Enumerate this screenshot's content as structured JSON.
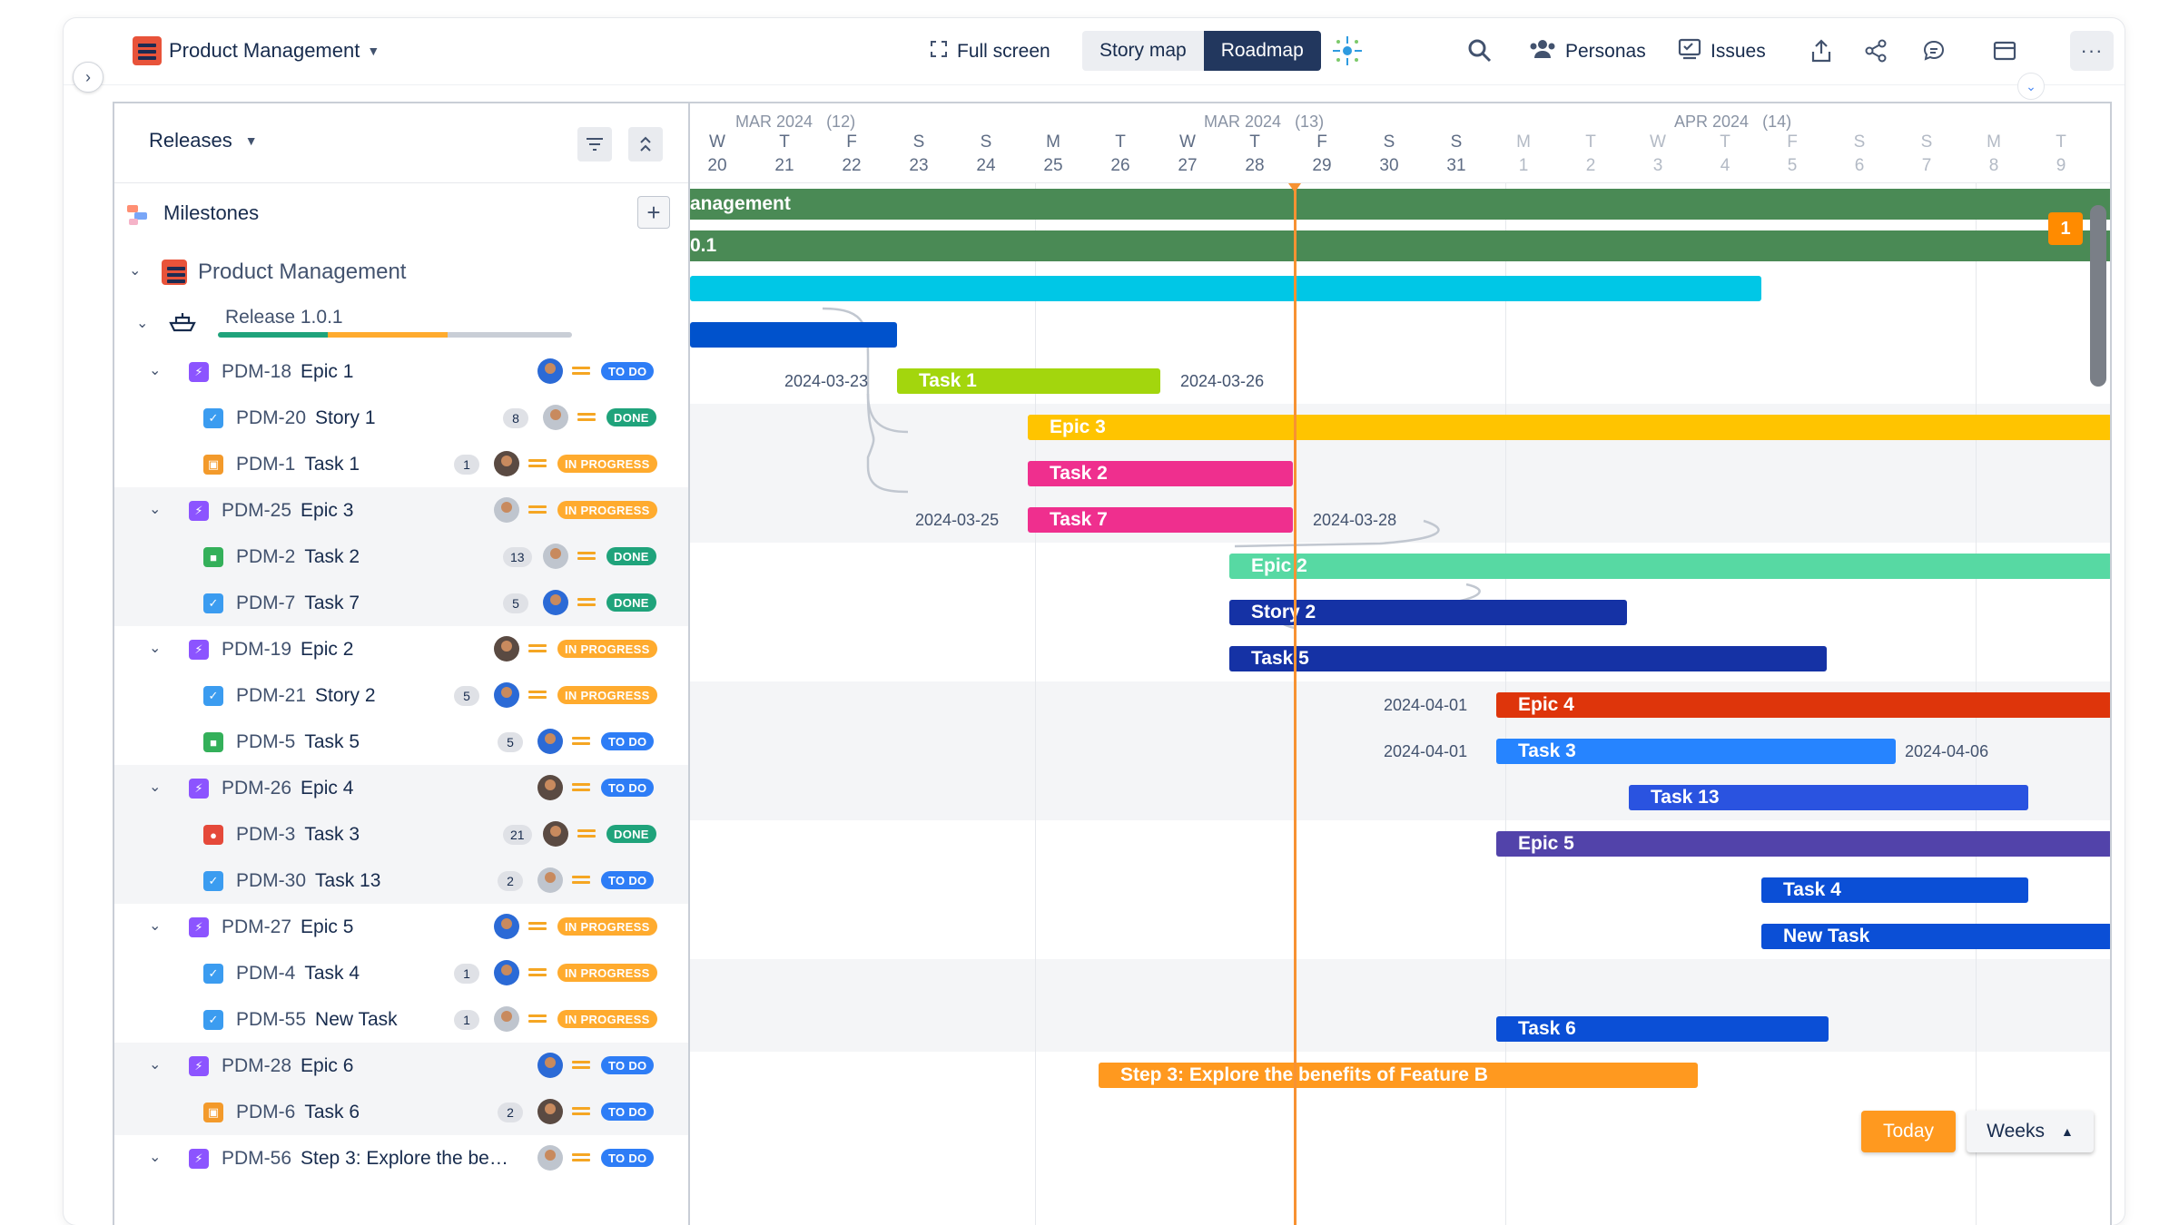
{
  "topbar": {
    "project_name": "Product Management",
    "full_screen": "Full screen",
    "story_map": "Story map",
    "roadmap": "Roadmap",
    "personas": "Personas",
    "issues": "Issues",
    "more": "···"
  },
  "left": {
    "releases_label": "Releases",
    "milestones_label": "Milestones",
    "project_label": "Product Management",
    "release_label": "Release 1.0.1",
    "release_progress": {
      "done": 0.31,
      "in_progress": 0.34,
      "todo": 0.35
    },
    "rows": [
      {
        "key": "PDM-18",
        "title": "Epic 1",
        "type": "epic",
        "count": "",
        "status": "TO DO",
        "status_kind": "todo",
        "avatar": "blue",
        "expandable": true,
        "shade": false
      },
      {
        "key": "PDM-20",
        "title": "Story 1",
        "type": "story",
        "count": "8",
        "status": "DONE",
        "status_kind": "done",
        "avatar": "grey",
        "expandable": false,
        "shade": false
      },
      {
        "key": "PDM-1",
        "title": "Task 1",
        "type": "task",
        "count": "1",
        "status": "IN PROGRESS",
        "status_kind": "prog",
        "avatar": "dark",
        "expandable": false,
        "shade": false
      },
      {
        "key": "PDM-25",
        "title": "Epic 3",
        "type": "epic",
        "count": "",
        "status": "IN PROGRESS",
        "status_kind": "prog",
        "avatar": "grey",
        "expandable": true,
        "shade": true
      },
      {
        "key": "PDM-2",
        "title": "Task 2",
        "type": "green",
        "count": "13",
        "status": "DONE",
        "status_kind": "done",
        "avatar": "grey",
        "expandable": false,
        "shade": true
      },
      {
        "key": "PDM-7",
        "title": "Task 7",
        "type": "story",
        "count": "5",
        "status": "DONE",
        "status_kind": "done",
        "avatar": "blue",
        "expandable": false,
        "shade": true
      },
      {
        "key": "PDM-19",
        "title": "Epic 2",
        "type": "epic",
        "count": "",
        "status": "IN PROGRESS",
        "status_kind": "prog",
        "avatar": "dark",
        "expandable": true,
        "shade": false
      },
      {
        "key": "PDM-21",
        "title": "Story 2",
        "type": "story",
        "count": "5",
        "status": "IN PROGRESS",
        "status_kind": "prog",
        "avatar": "blue",
        "expandable": false,
        "shade": false
      },
      {
        "key": "PDM-5",
        "title": "Task 5",
        "type": "green",
        "count": "5",
        "status": "TO DO",
        "status_kind": "todo",
        "avatar": "blue",
        "expandable": false,
        "shade": false
      },
      {
        "key": "PDM-26",
        "title": "Epic 4",
        "type": "epic",
        "count": "",
        "status": "TO DO",
        "status_kind": "todo",
        "avatar": "dark",
        "expandable": true,
        "shade": true
      },
      {
        "key": "PDM-3",
        "title": "Task 3",
        "type": "bug",
        "count": "21",
        "status": "DONE",
        "status_kind": "done",
        "avatar": "dark",
        "expandable": false,
        "shade": true
      },
      {
        "key": "PDM-30",
        "title": "Task 13",
        "type": "story",
        "count": "2",
        "status": "TO DO",
        "status_kind": "todo",
        "avatar": "grey",
        "expandable": false,
        "shade": true
      },
      {
        "key": "PDM-27",
        "title": "Epic 5",
        "type": "epic",
        "count": "",
        "status": "IN PROGRESS",
        "status_kind": "prog",
        "avatar": "blue",
        "expandable": true,
        "shade": false
      },
      {
        "key": "PDM-4",
        "title": "Task 4",
        "type": "story",
        "count": "1",
        "status": "IN PROGRESS",
        "status_kind": "prog",
        "avatar": "blue",
        "expandable": false,
        "shade": false
      },
      {
        "key": "PDM-55",
        "title": "New Task",
        "type": "story",
        "count": "1",
        "status": "IN PROGRESS",
        "status_kind": "prog",
        "avatar": "grey",
        "expandable": false,
        "shade": false
      },
      {
        "key": "PDM-28",
        "title": "Epic 6",
        "type": "epic",
        "count": "",
        "status": "TO DO",
        "status_kind": "todo",
        "avatar": "blue",
        "expandable": true,
        "shade": true
      },
      {
        "key": "PDM-6",
        "title": "Task 6",
        "type": "task",
        "count": "2",
        "status": "TO DO",
        "status_kind": "todo",
        "avatar": "dark",
        "expandable": false,
        "shade": true
      },
      {
        "key": "PDM-56",
        "title": "Step 3: Explore the be…",
        "type": "epic",
        "count": "",
        "status": "TO DO",
        "status_kind": "todo",
        "avatar": "grey",
        "expandable": true,
        "shade": false
      }
    ]
  },
  "timeline": {
    "months": [
      {
        "label": "MAR 2024",
        "week": "(12)"
      },
      {
        "label": "MAR 2024",
        "week": "(13)"
      },
      {
        "label": "APR 2024",
        "week": "(14)"
      }
    ],
    "days": [
      {
        "d": "W",
        "n": "20",
        "dim": false
      },
      {
        "d": "T",
        "n": "21",
        "dim": false
      },
      {
        "d": "F",
        "n": "22",
        "dim": false
      },
      {
        "d": "S",
        "n": "23",
        "dim": false
      },
      {
        "d": "S",
        "n": "24",
        "dim": false
      },
      {
        "d": "M",
        "n": "25",
        "dim": false
      },
      {
        "d": "T",
        "n": "26",
        "dim": false
      },
      {
        "d": "W",
        "n": "27",
        "dim": false
      },
      {
        "d": "T",
        "n": "28",
        "dim": false
      },
      {
        "d": "F",
        "n": "29",
        "dim": false
      },
      {
        "d": "S",
        "n": "30",
        "dim": false
      },
      {
        "d": "S",
        "n": "31",
        "dim": false
      },
      {
        "d": "M",
        "n": "1",
        "dim": true
      },
      {
        "d": "T",
        "n": "2",
        "dim": true
      },
      {
        "d": "W",
        "n": "3",
        "dim": true
      },
      {
        "d": "T",
        "n": "4",
        "dim": true
      },
      {
        "d": "F",
        "n": "5",
        "dim": true
      },
      {
        "d": "S",
        "n": "6",
        "dim": true
      },
      {
        "d": "S",
        "n": "7",
        "dim": true
      },
      {
        "d": "M",
        "n": "8",
        "dim": true
      },
      {
        "d": "T",
        "n": "9",
        "dim": true
      }
    ],
    "bars": {
      "project": "anagement",
      "release": "0.1",
      "task1": "Task 1",
      "epic3": "Epic 3",
      "task2": "Task 2",
      "task7": "Task 7",
      "epic2": "Epic 2",
      "story2": "Story 2",
      "task5": "Task 5",
      "epic4": "Epic 4",
      "task3": "Task 3",
      "task13": "Task 13",
      "epic5": "Epic 5",
      "task4": "Task 4",
      "newtask": "New Task",
      "task6": "Task 6",
      "step3": "Step 3: Explore the benefits of Feature B"
    },
    "dates": {
      "task1_start": "2024-03-23",
      "task1_end": "2024-03-26",
      "task7_start": "2024-03-25",
      "task7_end": "2024-03-28",
      "epic4_start": "2024-04-01",
      "task3_start": "2024-04-01",
      "task3_end": "2024-04-06"
    },
    "milestone_badge": "1",
    "today_button": "Today",
    "weeks_button": "Weeks"
  },
  "colors": {
    "accent": "#22375e",
    "today": "#f79232",
    "project_bar": "#4a8a55",
    "epic1": "#00c7e6",
    "story1": "#0052cc",
    "task1": "#a3d60d",
    "epic3": "#ffc400",
    "task2": "#ef2f8e",
    "epic2": "#57d9a3",
    "story2": "#1532a5",
    "epic4": "#de350b",
    "task3": "#2684ff",
    "task13": "#2a53e0",
    "epic5": "#5243aa",
    "task4": "#0b4fd6",
    "step3": "#ff991f"
  }
}
